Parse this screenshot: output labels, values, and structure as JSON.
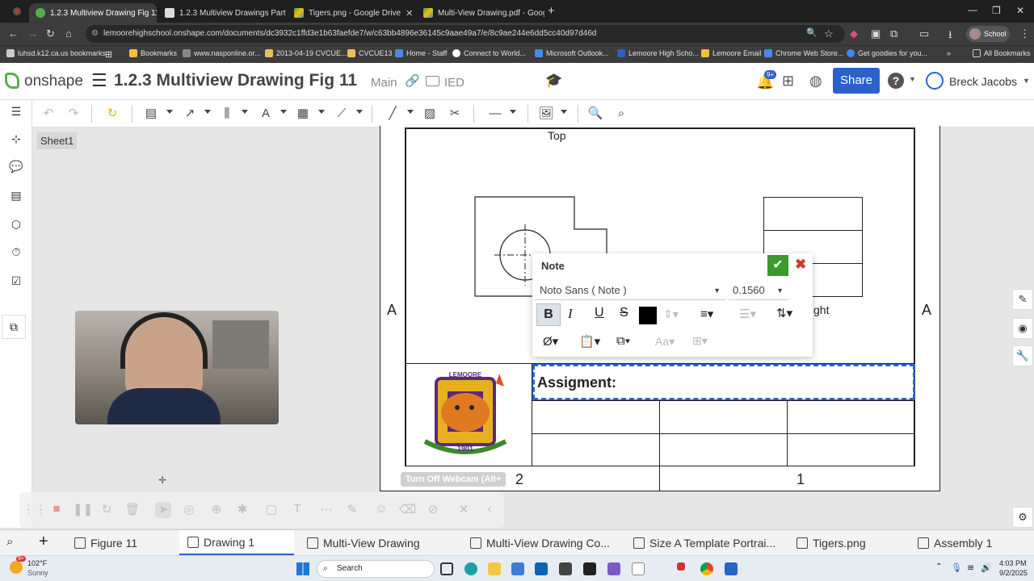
{
  "browser": {
    "tabs": [
      {
        "label": "1.2.3 Multiview Drawing Fig 11",
        "active": true
      },
      {
        "label": "1.2.3 Multiview Drawings Part 2"
      },
      {
        "label": "Tigers.png - Google Drive"
      },
      {
        "label": "Multi-View Drawing.pdf - Goog"
      }
    ],
    "url": "lemoorehighschool.onshape.com/documents/dc3932c1ffd3e1b63faefde7/w/c63bb4896e36145c9aae49a7/e/8c9ae244e6dd5cc40d97d46d",
    "profile": "School",
    "bookmarks": [
      "luhsd.k12.ca.us bookmarks",
      "Bookmarks",
      "www.nasponline.or...",
      "2013-04-19 CVCUE...",
      "CVCUE13",
      "Home - Staff",
      "Connect to World...",
      "Microsoft Outlook...",
      "Lemoore High Scho...",
      "Lemoore Email",
      "Chrome Web Store...",
      "Get goodies for you..."
    ],
    "all_bookmarks": "All Bookmarks"
  },
  "onshape": {
    "logo": "onshape",
    "doc_title": "1.2.3 Multiview Drawing Fig 11",
    "branch": "Main",
    "folder": "IED",
    "notif_count": "9+",
    "share": "Share",
    "user": "Breck Jacobs",
    "sheet": "Sheet1"
  },
  "drawing": {
    "view_top": "Top",
    "view_right_partial": "ght",
    "zone_left": "A",
    "zone_right": "A",
    "title_text": "Assigment:",
    "zone_bottom_2": "2",
    "zone_bottom_1": "1",
    "logo_text_top": "LEMOORE",
    "logo_text_bottom": "1901"
  },
  "note_dialog": {
    "title": "Note",
    "font": "Noto Sans ( Note )",
    "size": "0.1560"
  },
  "webcam": {
    "tooltip": "Turn Off Webcam (Alt+"
  },
  "doc_tabs": [
    "Figure 11",
    "Drawing 1",
    "Multi-View Drawing",
    "Multi-View Drawing Co...",
    "Size A Template Portrai...",
    "Tigers.png",
    "Assembly 1"
  ],
  "taskbar": {
    "temp": "102°F",
    "weather": "Sunny",
    "search": "Search",
    "time": "4:03 PM",
    "date": "9/2/2025",
    "badge": "9+"
  },
  "colors": {
    "onshape_blue": "#2a62c9",
    "check_green": "#3a9a2a",
    "close_red": "#d03b2b",
    "title_highlight": "#2a62c9"
  }
}
